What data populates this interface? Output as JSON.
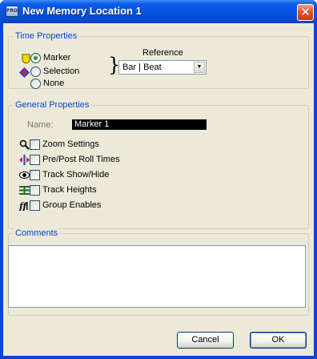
{
  "window": {
    "app_icon_text": "PRO",
    "title": "New Memory Location 1",
    "close_glyph": "✕"
  },
  "time_properties": {
    "group_title": "Time Properties",
    "options": [
      {
        "label": "Marker",
        "checked": true,
        "icon": "marker-shield-icon"
      },
      {
        "label": "Selection",
        "checked": false,
        "icon": "selection-icon"
      },
      {
        "label": "None",
        "checked": false,
        "icon": ""
      }
    ],
    "reference": {
      "label": "Reference",
      "value": "Bar | Beat",
      "arrow": "▼"
    }
  },
  "general_properties": {
    "group_title": "General Properties",
    "name_label": "Name:",
    "name_value": "Marker 1",
    "options": [
      {
        "label": "Zoom Settings",
        "checked": false,
        "icon": "zoom-icon"
      },
      {
        "label": "Pre/Post Roll Times",
        "checked": false,
        "icon": "pre-post-roll-icon"
      },
      {
        "label": "Track Show/Hide",
        "checked": false,
        "icon": "eye-icon"
      },
      {
        "label": "Track Heights",
        "checked": false,
        "icon": "track-heights-icon"
      },
      {
        "label": "Group Enables",
        "checked": false,
        "icon": "group-enables-icon"
      }
    ]
  },
  "comments": {
    "group_title": "Comments",
    "value": ""
  },
  "buttons": {
    "cancel": "Cancel",
    "ok": "OK"
  },
  "colors": {
    "title_bar": "#0653df",
    "group_title": "#0046d5",
    "dialog_bg": "#ece9d8",
    "close_button": "#e0552f"
  }
}
